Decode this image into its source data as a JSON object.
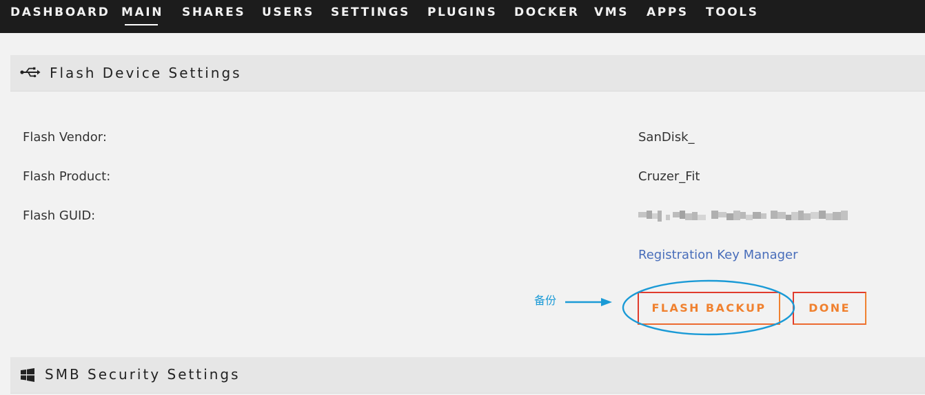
{
  "nav": {
    "items": [
      {
        "label": "DASHBOARD"
      },
      {
        "label": "MAIN"
      },
      {
        "label": "SHARES"
      },
      {
        "label": "USERS"
      },
      {
        "label": "SETTINGS"
      },
      {
        "label": "PLUGINS"
      },
      {
        "label": "DOCKER"
      },
      {
        "label": "VMS"
      },
      {
        "label": "APPS"
      },
      {
        "label": "TOOLS"
      }
    ],
    "active": "MAIN"
  },
  "flash_section": {
    "title": "Flash Device Settings",
    "icon": "usb-icon",
    "rows": [
      {
        "label": "Flash Vendor:",
        "value": "SanDisk_"
      },
      {
        "label": "Flash Product:",
        "value": "Cruzer_Fit"
      },
      {
        "label": "Flash GUID:",
        "value": ""
      }
    ],
    "link": "Registration Key Manager",
    "buttons": {
      "backup": "FLASH BACKUP",
      "done": "DONE"
    }
  },
  "annotation": {
    "text": "备份",
    "color": "#1a9ad6"
  },
  "smb_section": {
    "title": "SMB Security Settings",
    "icon": "windows-icon"
  },
  "colors": {
    "nav_bg": "#1c1c1c",
    "page_bg": "#f2f2f2",
    "header_bg": "#e6e6e6",
    "link": "#486dba",
    "button_text": "#f0812f",
    "button_border": "#e03b2c"
  }
}
